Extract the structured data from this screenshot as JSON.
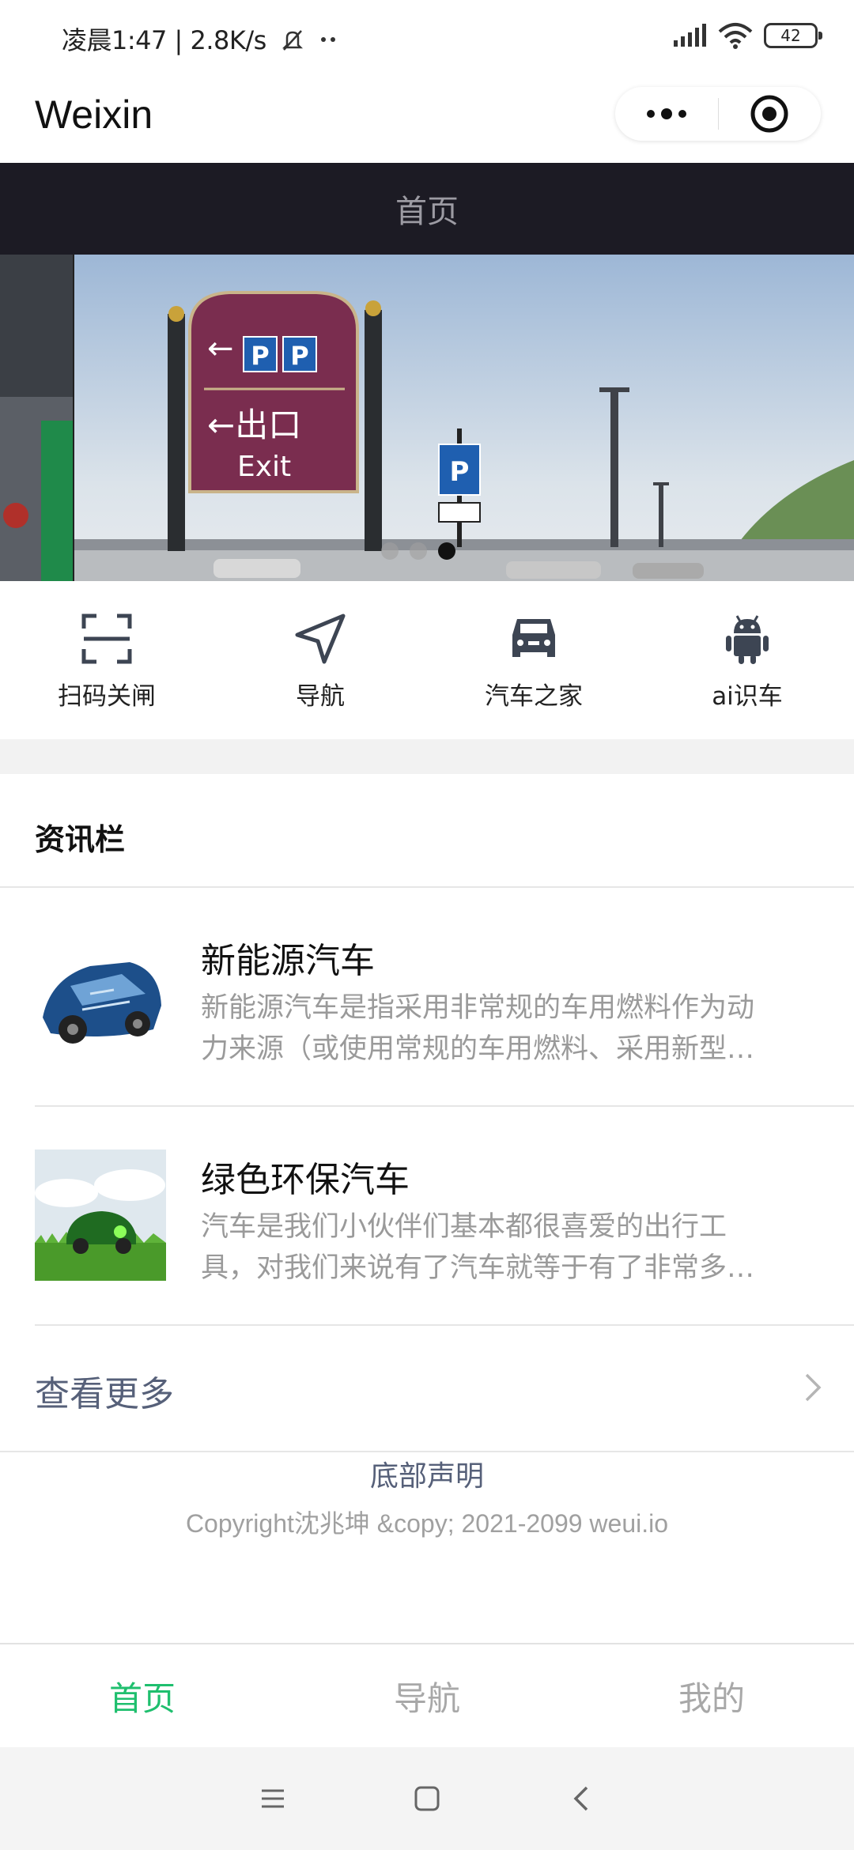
{
  "status_bar": {
    "left_text": "凌晨1:47 | 2.8K/s",
    "battery": "42",
    "icons": [
      "mute-bell-icon",
      "dots-icon",
      "signal-icon",
      "wifi-icon",
      "battery-icon"
    ]
  },
  "nav": {
    "title": "Weixin",
    "menu_icon": "more-dots-icon",
    "close_icon": "target-close-icon"
  },
  "page_header": {
    "title": "首页"
  },
  "banner": {
    "slide_count": 3,
    "active_index": 2,
    "sign": {
      "line1": "←P P",
      "line2": "←出口",
      "line3": "Exit"
    }
  },
  "quick_nav": [
    {
      "label": "扫码关闸",
      "icon": "scan-icon"
    },
    {
      "label": "导航",
      "icon": "navigation-arrow-icon"
    },
    {
      "label": "汽车之家",
      "icon": "car-icon"
    },
    {
      "label": "ai识车",
      "icon": "android-icon"
    }
  ],
  "news": {
    "heading": "资讯栏",
    "items": [
      {
        "title": "新能源汽车",
        "desc_line1": "新能源汽车是指采用非常规的车用燃料作为动",
        "desc_line2": "力来源（或使用常规的车用燃料、采用新型…"
      },
      {
        "title": "绿色环保汽车",
        "desc_line1": "汽车是我们小伙伴们基本都很喜爱的出行工",
        "desc_line2": "具，对我们来说有了汽车就等于有了非常多…"
      }
    ],
    "more_label": "查看更多"
  },
  "footer": {
    "link": "底部声明",
    "copyright": "Copyright沈兆坤 &copy; 2021-2099 weui.io"
  },
  "tabbar": [
    {
      "label": "首页",
      "active": true
    },
    {
      "label": "导航",
      "active": false
    },
    {
      "label": "我的",
      "active": false
    }
  ],
  "colors": {
    "accent_green": "#1fbf6e",
    "header_dark": "#1c1b24",
    "link_gray_blue": "#566079"
  }
}
